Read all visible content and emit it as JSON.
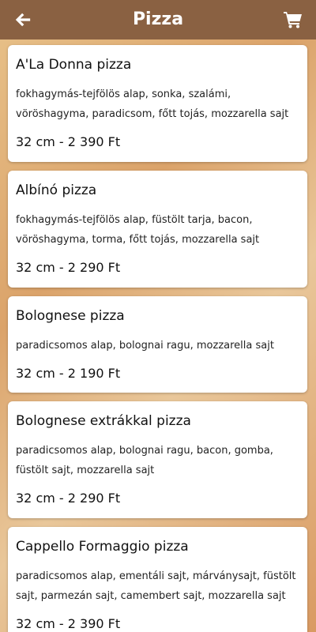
{
  "header": {
    "title": "Pizza",
    "back_icon": "arrow-left-icon",
    "cart_icon": "shopping-cart-icon",
    "bar_color": "#8a6142"
  },
  "pizzas": [
    {
      "name": "A'La Donna pizza",
      "description": "fokhagymás-tejfölös alap, sonka, szalámi, vöröshagyma, paradicsom, főtt tojás, mozzarella  sajt",
      "price": "32 cm - 2 390 Ft"
    },
    {
      "name": "Albínó pizza",
      "description": "fokhagymás-tejfölös alap, füstölt tarja, bacon, vöröshagyma, torma, főtt tojás, mozzarella  sajt",
      "price": "32 cm - 2 290 Ft"
    },
    {
      "name": "Bolognese pizza",
      "description": "paradicsomos alap, bolognai ragu, mozzarella  sajt",
      "price": "32 cm - 2 190 Ft"
    },
    {
      "name": "Bolognese extrákkal pizza",
      "description": "paradicsomos alap, bolognai ragu, bacon, gomba, füstölt sajt, mozzarella  sajt",
      "price": "32 cm - 2 290 Ft"
    },
    {
      "name": "Cappello Formaggio pizza",
      "description": "paradicsomos alap, ementáli sajt, márványsajt, füstölt sajt, parmezán sajt, camembert sajt, mozzarella  sajt",
      "price": "32 cm - 2 390 Ft"
    }
  ]
}
